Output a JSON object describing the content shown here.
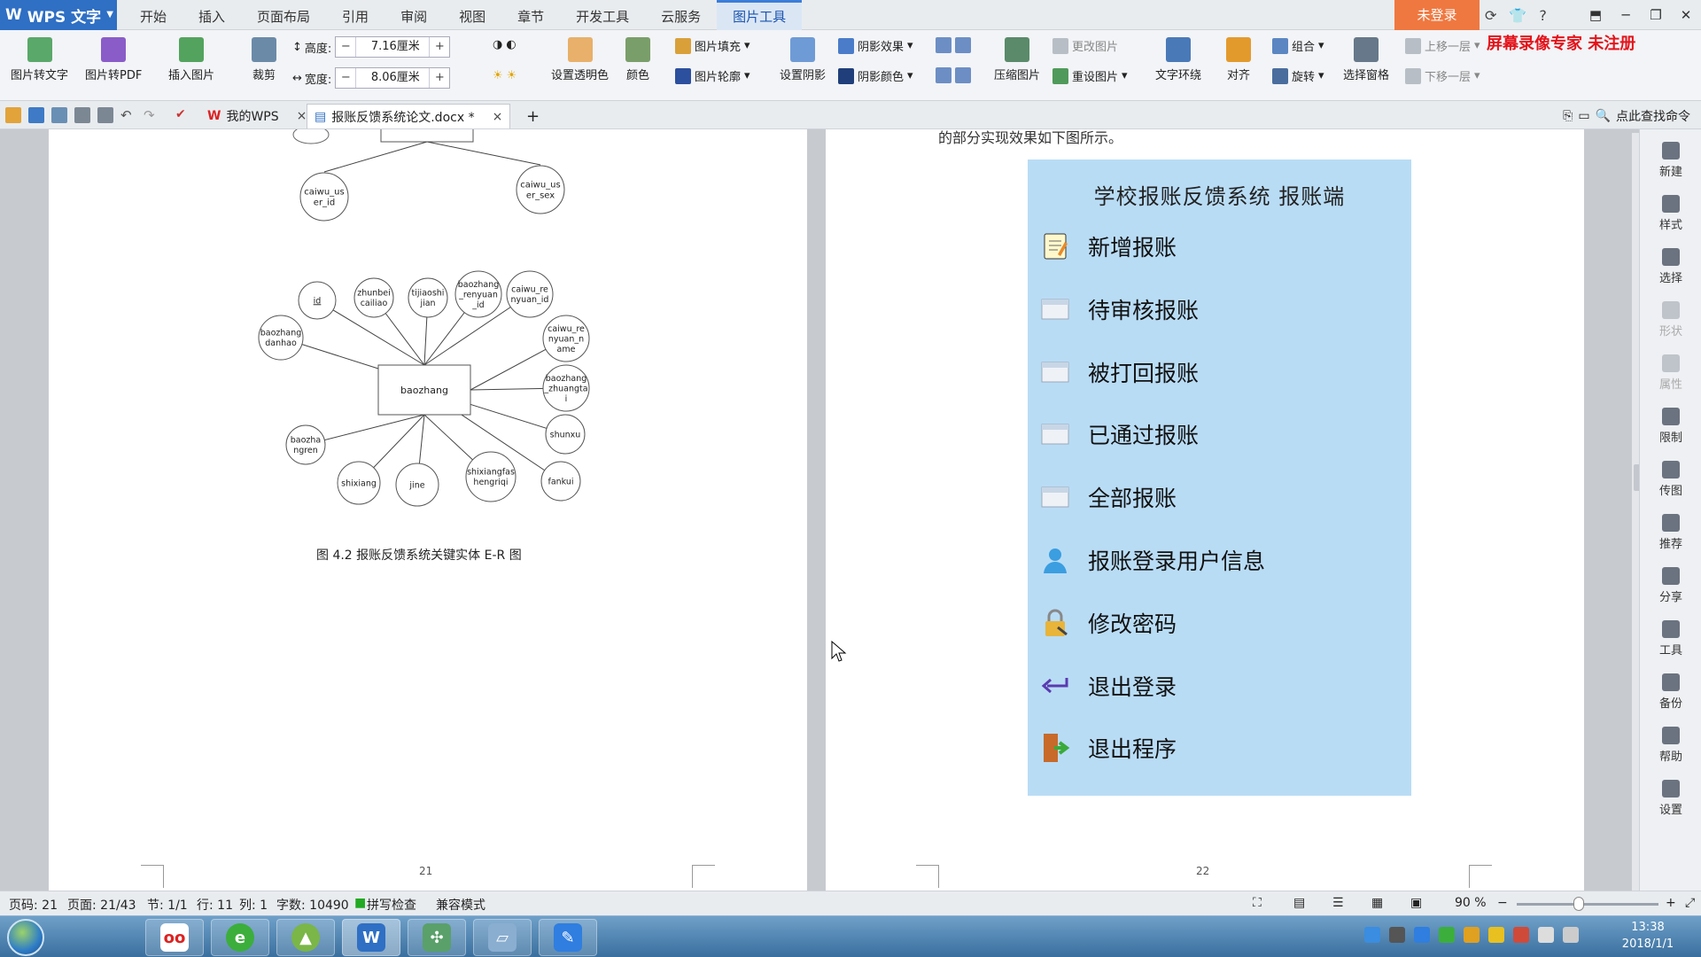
{
  "app": {
    "logo": "WPS 文字",
    "logo_icon": "wps-w-icon"
  },
  "menu_tabs": [
    "开始",
    "插入",
    "页面布局",
    "引用",
    "审阅",
    "视图",
    "章节",
    "开发工具",
    "云服务",
    "图片工具"
  ],
  "active_tab": "图片工具",
  "login": "未登录",
  "watermark": "屏幕录像专家 未注册",
  "ribbon": {
    "pic_to_text": "图片转文字",
    "pic_to_pdf": "图片转PDF",
    "insert_pic": "插入图片",
    "crop": "裁剪",
    "height_label": "高度:",
    "height_value": "7.16厘米",
    "width_label": "宽度:",
    "width_value": "8.06厘米",
    "spin_minus": "−",
    "spin_plus": "+",
    "set_transparent": "设置透明色",
    "color": "颜色",
    "pic_fill": "图片填充",
    "pic_outline": "图片轮廓",
    "set_shadow": "设置阴影",
    "shadow_effect": "阴影效果",
    "shadow_color": "阴影颜色",
    "compress": "压缩图片",
    "change_pic": "更改图片",
    "reset_pic": "重设图片",
    "text_wrap": "文字环绕",
    "align": "对齐",
    "group": "组合",
    "rotate": "旋转",
    "select_pane": "选择窗格",
    "bring_forward": "上移一层",
    "send_backward": "下移一层"
  },
  "doc_tabs": [
    {
      "label": "我的WPS",
      "close": "×"
    },
    {
      "label": "报账反馈系统论文.docx *",
      "close": "×"
    }
  ],
  "new_tab": "+",
  "find_command": "点此查找命令",
  "page1": {
    "caption": "图 4.2   报账反馈系统关键实体 E-R 图",
    "page_number": "21",
    "er_top": {
      "nodes": [
        "caiwu_us\ner_id",
        "caiwu_us\ner_sex"
      ]
    },
    "er_main": {
      "entity": "baozhang",
      "attributes": [
        "id",
        "zhunbei\ncailiao",
        "tijiaoshi\njian",
        "baozhang\n_renyuan\n_id",
        "caiwu_re\nnyuan_id",
        "baozhang\ndanhao",
        "caiwu_re\nnyuan_n\name",
        "baozhang\n_zhuangta\ni",
        "shunxu",
        "fankui",
        "shixiangfas\nhengriqi",
        "jine",
        "shixiang",
        "baozha\nngren"
      ]
    }
  },
  "page2": {
    "top_text": "的部分实现效果如下图所示。",
    "page_number": "22",
    "menu": {
      "title": "学校报账反馈系统 报账端",
      "items": [
        {
          "label": "新增报账",
          "icon": "notepad-icon"
        },
        {
          "label": "待审核报账",
          "icon": "window-icon"
        },
        {
          "label": "被打回报账",
          "icon": "window-icon"
        },
        {
          "label": "已通过报账",
          "icon": "window-icon"
        },
        {
          "label": "全部报账",
          "icon": "window-icon"
        },
        {
          "label": "报账登录用户信息",
          "icon": "user-icon"
        },
        {
          "label": "修改密码",
          "icon": "lock-icon"
        },
        {
          "label": "退出登录",
          "icon": "return-arrow-icon"
        },
        {
          "label": "退出程序",
          "icon": "exit-door-icon"
        }
      ]
    }
  },
  "sidebar": [
    "新建",
    "样式",
    "选择",
    "形状",
    "属性",
    "限制",
    "传图",
    "推荐",
    "分享",
    "工具",
    "备份",
    "帮助",
    "设置"
  ],
  "status": {
    "page_code": "页码: 21",
    "page": "页面: 21/43",
    "section": "节: 1/1",
    "row": "行: 11",
    "col": "列: 1",
    "word_count": "字数: 10490",
    "spell_check": "拼写检查",
    "compat": "兼容模式",
    "zoom": "90 %",
    "zoom_minus": "−",
    "zoom_plus": "+"
  },
  "taskbar": {
    "apps": [
      "start-orb",
      "oo-player",
      "green-browser",
      "android-tool",
      "wps-writer",
      "network-tool",
      "document-tool",
      "note-tool"
    ],
    "app_wps_glyph": "W",
    "time": "13:38",
    "date": "2018/1/1"
  },
  "colors": {
    "accent": "#2f6fc4",
    "login": "#ef7840",
    "menu_bg": "#b9dcf5",
    "watermark": "#e4131a"
  }
}
